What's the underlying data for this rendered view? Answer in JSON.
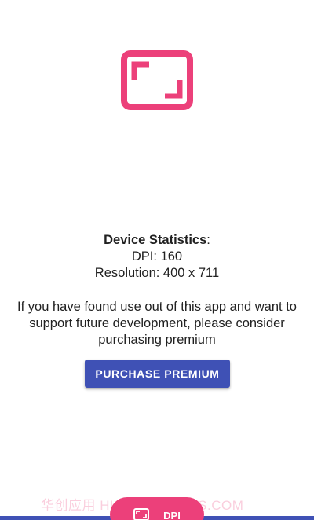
{
  "colors": {
    "accent_pink": "#ec407a",
    "primary_indigo": "#3f51b5",
    "text": "#212121"
  },
  "logo": {
    "icon": "fullscreen-frame-icon"
  },
  "stats": {
    "heading": "Device Statistics",
    "heading_suffix": ":",
    "dpi_line": "DPI: 160",
    "resolution_line": "Resolution: 400 x 711"
  },
  "support": {
    "message": "If you have found use out of this app and want to support future development, please consider purchasing premium"
  },
  "purchase_button": {
    "label": "PURCHASE PREMIUM"
  },
  "watermark": {
    "text": "华创应用  HUACHUANGZS.COM"
  },
  "bottom_nav": {
    "tab_label": "DPI",
    "tab_icon": "fullscreen-frame-icon"
  }
}
